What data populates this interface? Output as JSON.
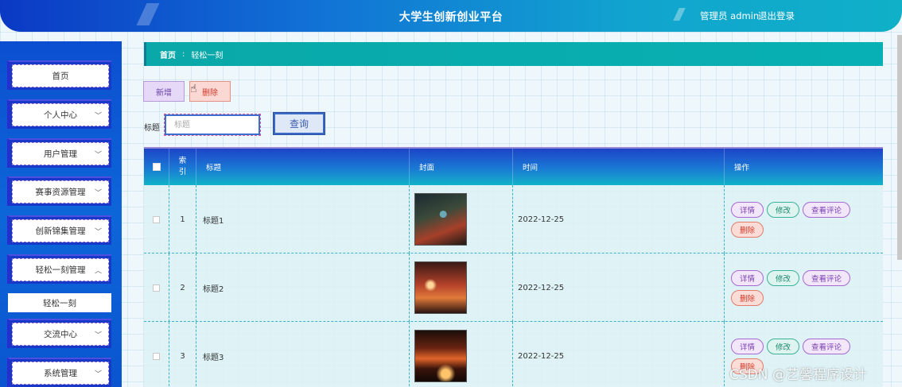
{
  "header": {
    "title": "大学生创新创业平台",
    "user": "管理员 admin",
    "logout": "退出登录"
  },
  "sidebar": {
    "items": [
      {
        "label": "首页",
        "arrow": ""
      },
      {
        "label": "个人中心",
        "arrow": "﹀"
      },
      {
        "label": "用户管理",
        "arrow": "﹀"
      },
      {
        "label": "赛事资源管理",
        "arrow": "﹀"
      },
      {
        "label": "创新锦集管理",
        "arrow": "﹀"
      },
      {
        "label": "轻松一刻管理",
        "arrow": "︿"
      },
      {
        "label": "交流中心",
        "arrow": "﹀"
      },
      {
        "label": "系统管理",
        "arrow": "﹀"
      }
    ],
    "submenu": "轻松一刻"
  },
  "breadcrumb": {
    "home": "首页",
    "sep": ":",
    "current": "轻松一刻"
  },
  "toolbar": {
    "add": "新增",
    "delete": "删除"
  },
  "search": {
    "label": "标题",
    "placeholder": "标题",
    "button": "查询"
  },
  "table": {
    "headers": [
      "索引",
      "标题",
      "封面",
      "时间",
      "操作"
    ],
    "rows": [
      {
        "index": "1",
        "title": "标题1",
        "time": "2022-12-25"
      },
      {
        "index": "2",
        "title": "标题2",
        "time": "2022-12-25"
      },
      {
        "index": "3",
        "title": "标题3",
        "time": "2022-12-25"
      }
    ],
    "actions": {
      "detail": "详情",
      "edit": "修改",
      "comments": "查看评论",
      "delete": "删除"
    }
  },
  "watermark": "CSDN @艺馨程序设计",
  "colors": {
    "header_start": "#0b39c4",
    "header_end": "#10b0c8",
    "breadcrumb": "#0aa8a8",
    "sidebar": "#0b4fd0"
  }
}
